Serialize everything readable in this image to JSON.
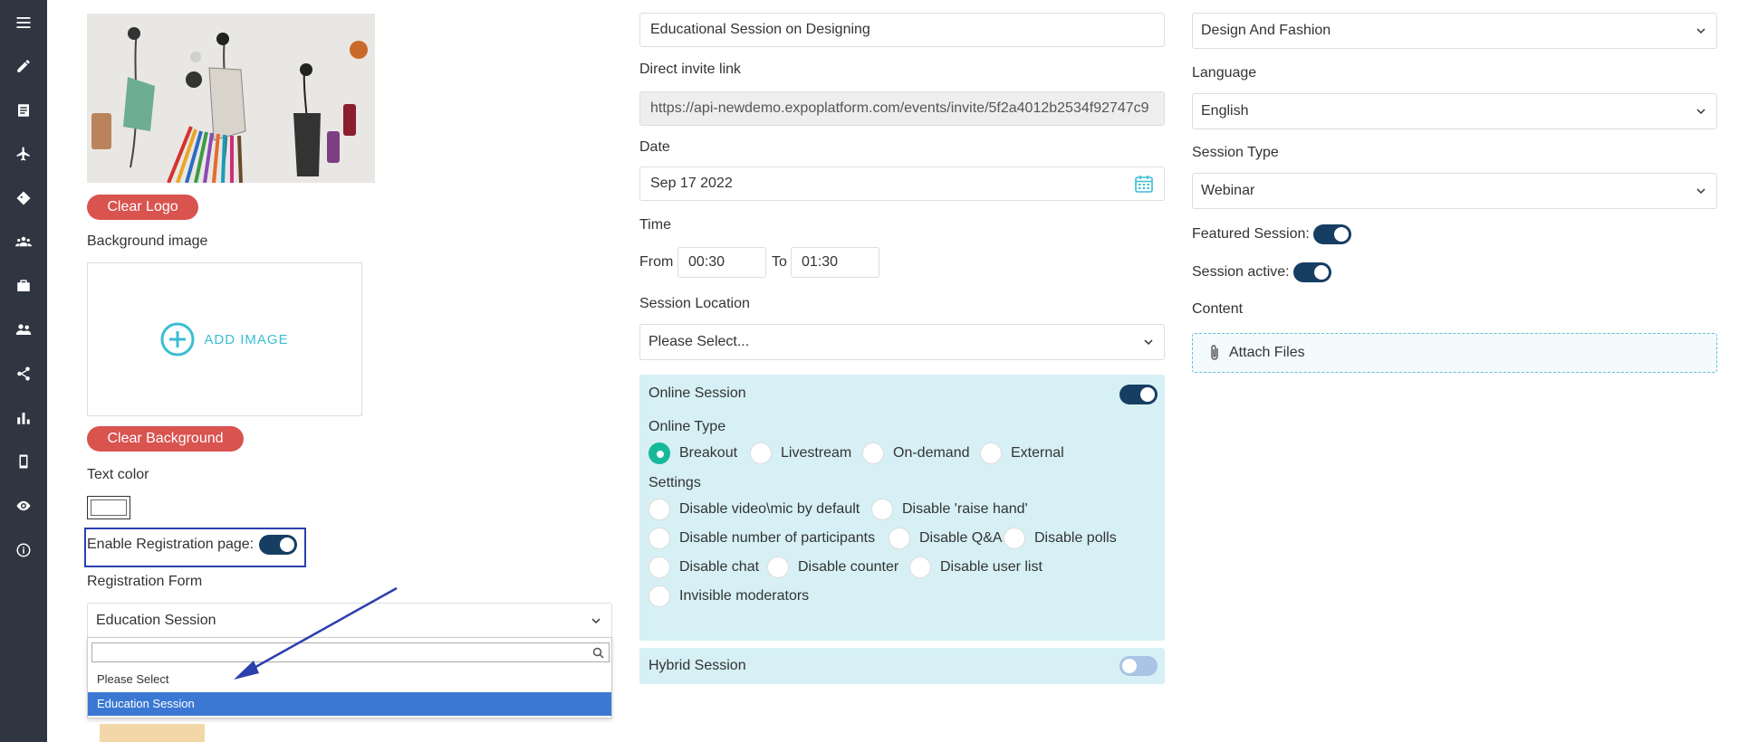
{
  "sidebar": {
    "icons": [
      "menu-icon",
      "pencil-icon",
      "document-icon",
      "plane-icon",
      "tag-icon",
      "group-icon",
      "briefcase-icon",
      "users-icon",
      "share-icon",
      "bar-chart-icon",
      "mobile-icon",
      "eye-icon",
      "info-icon"
    ]
  },
  "left": {
    "clear_logo": "Clear Logo",
    "background_image_label": "Background image",
    "add_image": "ADD IMAGE",
    "clear_background": "Clear Background",
    "text_color_label": "Text color",
    "enable_registration_label": "Enable Registration page:",
    "registration_form_label": "Registration Form",
    "registration_form_value": "Education Session",
    "dropdown_options": [
      "Please Select",
      "Education Session"
    ]
  },
  "middle": {
    "session_name": "Educational Session on Designing",
    "invite_label": "Direct invite link",
    "invite_value": "https://api-newdemo.expoplatform.com/events/invite/5f2a4012b2534f92747c9",
    "date_label": "Date",
    "date_value": "Sep 17 2022",
    "time_label": "Time",
    "from_label": "From",
    "from_value": "00:30",
    "to_label": "To",
    "to_value": "01:30",
    "location_label": "Session Location",
    "location_value": "Please Select...",
    "online_session_label": "Online Session",
    "online_type_label": "Online Type",
    "online_types": [
      "Breakout",
      "Livestream",
      "On-demand",
      "External"
    ],
    "settings_label": "Settings",
    "settings": {
      "disable_video": "Disable video\\mic by default",
      "disable_raise_hand": "Disable 'raise hand'",
      "disable_participants": "Disable number of participants",
      "disable_qa": "Disable Q&A",
      "disable_polls": "Disable polls",
      "disable_chat": "Disable chat",
      "disable_counter": "Disable counter",
      "disable_user_list": "Disable user list",
      "invisible_moderators": "Invisible moderators"
    },
    "hybrid_session_label": "Hybrid Session"
  },
  "right": {
    "category_value": "Design And Fashion",
    "language_label": "Language",
    "language_value": "English",
    "session_type_label": "Session Type",
    "session_type_value": "Webinar",
    "featured_label": "Featured Session:",
    "active_label": "Session active:",
    "content_label": "Content",
    "attach_files": "Attach Files"
  },
  "colors": {
    "sidebar": "#2f3541",
    "danger": "#d9534f",
    "toggle_on": "#163e63",
    "panel": "#d6f0f5",
    "radio_on": "#17b99b",
    "highlight_box": "#2c3fae",
    "selected_option": "#3b78d4"
  }
}
